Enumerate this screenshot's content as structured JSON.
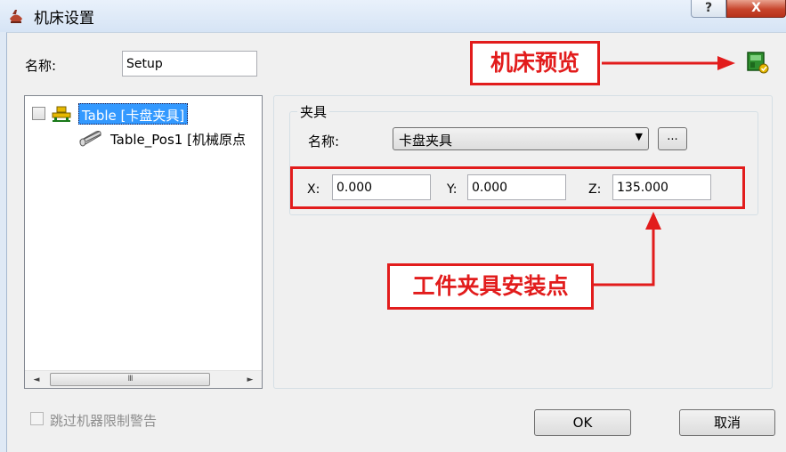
{
  "window": {
    "title": "机床设置",
    "help_label": "?",
    "close_label": "X"
  },
  "name_row": {
    "label": "名称:",
    "value": "Setup"
  },
  "tree": {
    "root_label": "Table [卡盘夹具]",
    "child_label": "Table_Pos1 [机械原点",
    "scroll_thumb": "III",
    "scroll_left": "◄",
    "scroll_right": "►"
  },
  "fixture_group": {
    "title": "夹具",
    "name_label": "名称:",
    "selected": "卡盘夹具",
    "dropdown_arrow": "▼",
    "browse_label": "...",
    "x_label": "X:",
    "x_value": "0.000",
    "y_label": "Y:",
    "y_value": "0.000",
    "z_label": "Z:",
    "z_value": "135.000"
  },
  "footer": {
    "skip_warning_label": "跳过机器限制警告",
    "ok_label": "OK",
    "cancel_label": "取消"
  },
  "annotations": {
    "preview_callout": "机床预览",
    "mount_point_callout": "工件夹具安装点",
    "color": "#e21c1c"
  },
  "icons": {
    "app": "tool-holder-icon",
    "table": "fixture-table-icon",
    "position": "cylinder-position-icon",
    "preview": "machine-preview-icon"
  },
  "colors": {
    "selection": "#3399ff",
    "annotation": "#e21c1c"
  }
}
